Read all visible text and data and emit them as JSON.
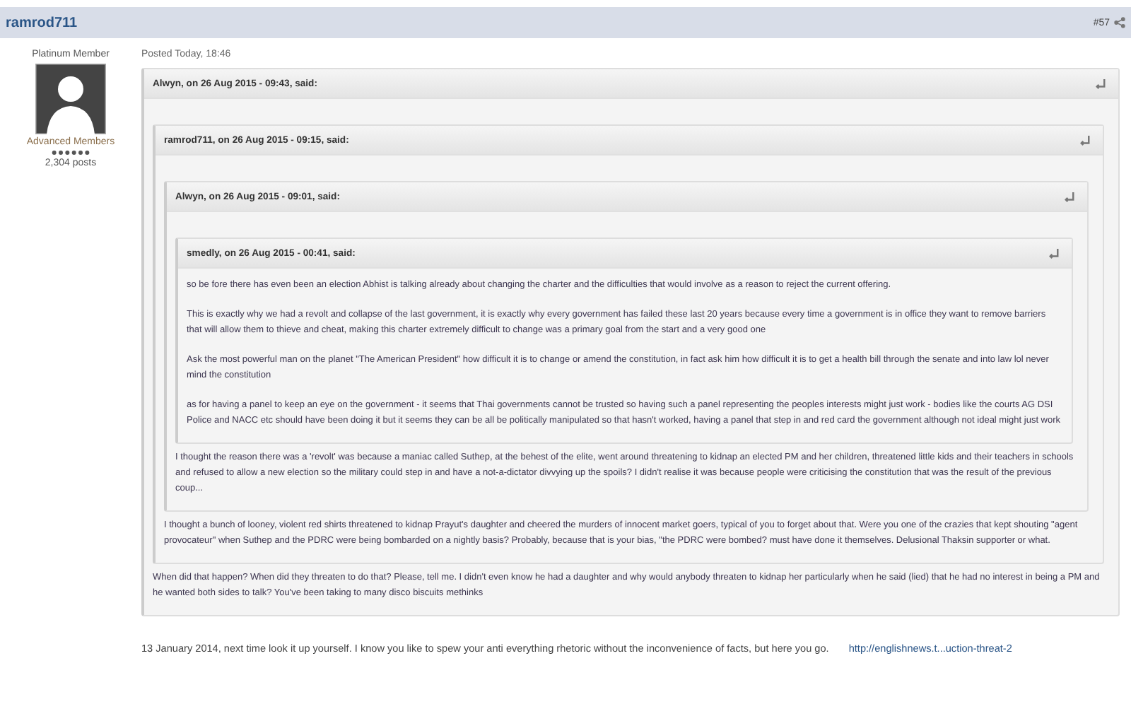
{
  "post": {
    "author": "ramrod711",
    "number": "#57",
    "member_title": "Platinum Member",
    "group": "Advanced Members",
    "posts": "2,304 posts",
    "posted": "Posted Today, 18:46",
    "quote": {
      "citation": "Alwyn, on 26 Aug 2015 - 09:43, said:",
      "quote": {
        "citation": "ramrod711, on 26 Aug 2015 - 09:15, said:",
        "quote": {
          "citation": "Alwyn, on 26 Aug 2015 - 09:01, said:",
          "quote": {
            "citation": "smedly, on 26 Aug 2015 - 00:41, said:",
            "paragraphs": [
              "so be fore there has even been an election Abhist is talking already about changing the charter and the difficulties that would involve as a reason to reject the current offering.",
              "This is exactly why we had a revolt and collapse of the last government, it is exactly why every government has failed these last 20 years because every time a government is in office they want to remove barriers that will allow them to thieve and cheat, making this charter extremely difficult to change was  a primary goal from the start and a very good one",
              "Ask the most powerful man on the planet \"The American President\" how difficult it is to change or amend the constitution, in fact ask him how difficult it is to get a health bill through the senate and into law lol never mind the constitution",
              "as for having a panel to keep an eye on the government - it seems that Thai governments cannot be trusted so having such a panel representing the peoples interests might just work - bodies like the courts AG DSI Police and NACC etc should have been doing it but it seems they can be all be politically manipulated so that hasn't worked, having a panel that step in and red card the government although not ideal might just work"
            ]
          },
          "paragraphs": [
            "I thought the reason there was a 'revolt' was because a maniac called Suthep, at the behest of the elite, went around threatening to kidnap an elected PM and her children, threatened little kids and their teachers in schools and refused to allow a new election so the military could step in and have a not-a-dictator divvying up the spoils? I didn't realise it was because people were criticising the constitution that was the result of the previous coup..."
          ]
        },
        "paragraphs": [
          "I thought a bunch of looney, violent red shirts threatened to kidnap Prayut's daughter and cheered the murders of innocent market goers, typical of you to forget about that. Were you one of the crazies that kept shouting \"agent provocateur\" when Suthep and the PDRC were being bombarded on a nightly basis? Probably, because that is your bias, \"the PDRC were bombed? must have done it themselves. Delusional Thaksin supporter or what."
        ]
      },
      "paragraphs": [
        "When did that happen? When did they threaten to do that? Please, tell me. I didn't even know he had a daughter and why would anybody threaten to kidnap her particularly when he said (lied) that he had no interest in being a PM and he wanted both sides to talk? You've been taking to many disco biscuits methinks"
      ]
    },
    "reply": "13 January 2014, next time look it up yourself. I know you like to spew your anti everything rhetoric without the inconvenience of facts, but here you go.",
    "link": "http://englishnews.t...uction-threat-2"
  }
}
